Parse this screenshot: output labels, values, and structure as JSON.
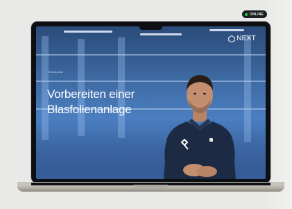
{
  "status_badge": {
    "label": "ONLINE",
    "dot_color": "#27d04a"
  },
  "brand": {
    "name": "NEXT",
    "icon": "hexagon-logo-icon"
  },
  "video": {
    "kicker": "Videotutorial",
    "title_line1": "Vorbereiten einer",
    "title_line2": "Blasfolienanlage"
  },
  "presenter": {
    "shirt_logo_icon": "r-logo-icon"
  }
}
